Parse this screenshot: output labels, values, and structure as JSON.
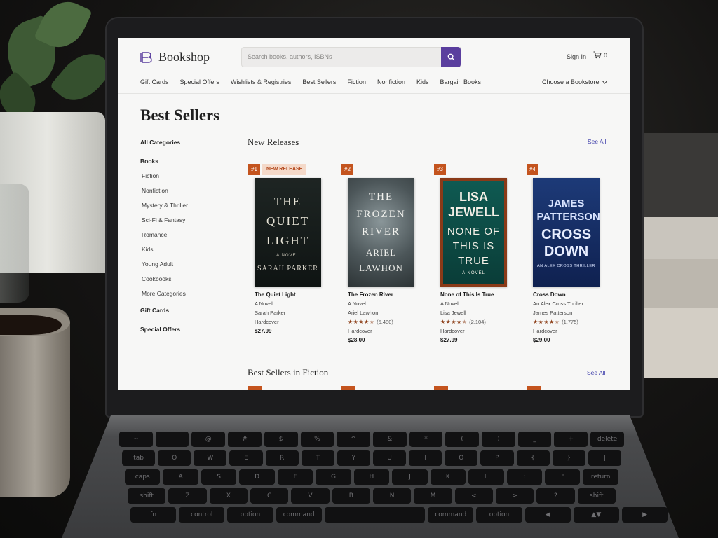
{
  "header": {
    "logo": "Bookshop",
    "search_placeholder": "Search books, authors, ISBNs",
    "signin": "Sign In",
    "cart_count": "0",
    "nav": [
      "Gift Cards",
      "Special Offers",
      "Wishlists & Registries",
      "Best Sellers",
      "Fiction",
      "Nonfiction",
      "Kids",
      "Bargain Books"
    ],
    "store_chooser": "Choose a Bookstore"
  },
  "page_title": "Best Sellers",
  "sidebar": {
    "all_categories": "All Categories",
    "books_head": "Books",
    "book_items": [
      "Fiction",
      "Nonfiction",
      "Mystery & Thriller",
      "Sci-Fi & Fantasy",
      "Romance",
      "Kids",
      "Young Adult",
      "Cookbooks",
      "More Categories"
    ],
    "gift_cards": "Gift Cards",
    "special_offers": "Special Offers"
  },
  "sections": {
    "new_releases": "New Releases",
    "fiction": "Best Sellers in Fiction",
    "see_all": "See All"
  },
  "books": [
    {
      "rank": "#1",
      "badge": "NEW RELEASE",
      "cover_title": "THE QUIET LIGHT",
      "cover_sub": "A NOVEL",
      "cover_author": "SARAH PARKER",
      "title": "The Quiet Light",
      "subtitle": "A Novel",
      "author": "Sarah Parker",
      "format": "Hardcover",
      "price": "$27.99",
      "rating": null,
      "reviews": null
    },
    {
      "rank": "#2",
      "badge": null,
      "cover_title": "THE FROZEN RIVER",
      "cover_sub": "",
      "cover_author": "ARIEL LAWHON",
      "title": "The Frozen River",
      "subtitle": "A Novel",
      "author": "Ariel Lawhon",
      "format": "Hardcover",
      "price": "$28.00",
      "rating": 4.5,
      "reviews": "(5,480)"
    },
    {
      "rank": "#3",
      "badge": null,
      "cover_title": "LISA JEWELL",
      "cover_sub": "A NOVEL",
      "cover_author": "NONE OF THIS IS TRUE",
      "title": "None of This Is True",
      "subtitle": "A Novel",
      "author": "Lisa Jewell",
      "format": "Hardcover",
      "price": "$27.99",
      "rating": 4.5,
      "reviews": "(2,104)"
    },
    {
      "rank": "#4",
      "badge": null,
      "cover_title": "JAMES PATTERSON",
      "cover_sub": "AN ALEX CROSS THRILLER",
      "cover_author": "CROSS DOWN",
      "title": "Cross Down",
      "subtitle": "An Alex Cross Thriller",
      "author": "James Patterson",
      "format": "Hardcover",
      "price": "$29.00",
      "rating": 4.5,
      "reviews": "(1,775)"
    }
  ],
  "colors": {
    "accent": "#5a3e9e",
    "rank_badge": "#c4541e",
    "new_release_bg": "#f4d9c9",
    "link": "#3a3aa8"
  },
  "keyboard": {
    "rows": [
      [
        "~",
        "!",
        "@",
        "#",
        "$",
        "%",
        "^",
        "&",
        "*",
        "(",
        ")",
        "_",
        "+",
        "delete"
      ],
      [
        "tab",
        "Q",
        "W",
        "E",
        "R",
        "T",
        "Y",
        "U",
        "I",
        "O",
        "P",
        "{",
        "}",
        "|"
      ],
      [
        "caps",
        "A",
        "S",
        "D",
        "F",
        "G",
        "H",
        "J",
        "K",
        "L",
        ":",
        "\"",
        "return"
      ],
      [
        "shift",
        "Z",
        "X",
        "C",
        "V",
        "B",
        "N",
        "M",
        "<",
        ">",
        "?",
        "shift"
      ],
      [
        "fn",
        "control",
        "option",
        "command",
        "",
        "command",
        "option",
        "◀",
        "▲▼",
        "▶"
      ]
    ]
  }
}
